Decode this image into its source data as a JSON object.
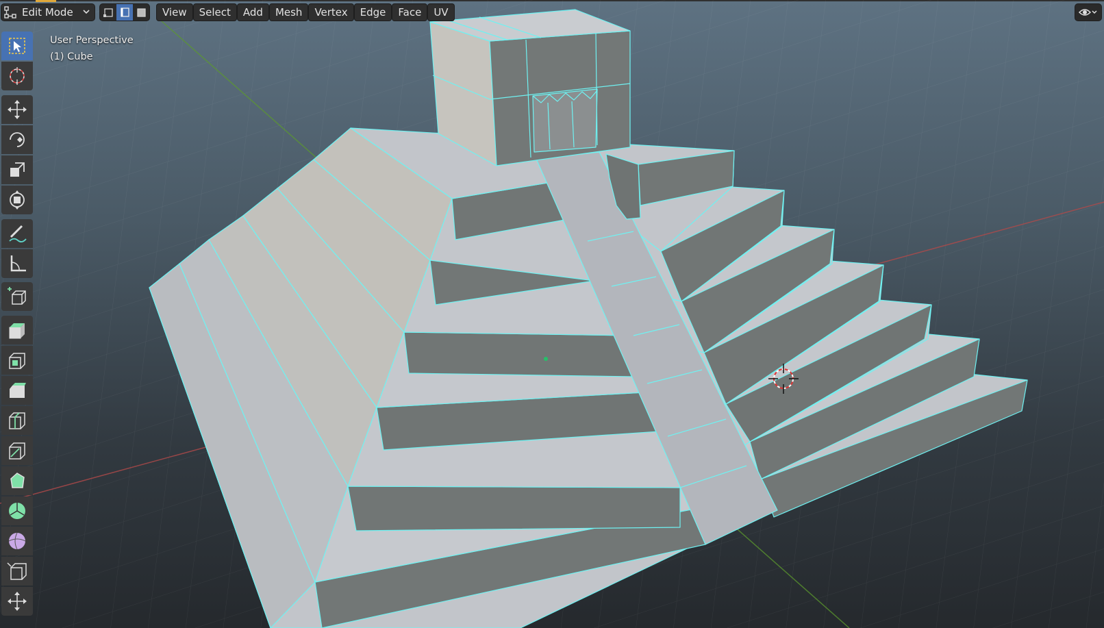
{
  "header": {
    "mode": "Edit Mode",
    "menus": [
      "View",
      "Select",
      "Add",
      "Mesh",
      "Vertex",
      "Edge",
      "Face",
      "UV"
    ]
  },
  "overlay": {
    "view_name": "User Perspective",
    "object_name": "(1) Cube"
  },
  "colors": {
    "accent": "#4772b3",
    "wire": "#6ff2f2",
    "face_light": "#c3c6cb",
    "face_dark": "#717675",
    "axis_x": "#b24a4a",
    "axis_y": "#5c9a2e"
  },
  "icons": {
    "mode": "edit-mode-icon",
    "select_modes": [
      "vertex-select-icon",
      "edge-select-icon",
      "face-select-icon"
    ],
    "visibility": "eye-icon"
  }
}
